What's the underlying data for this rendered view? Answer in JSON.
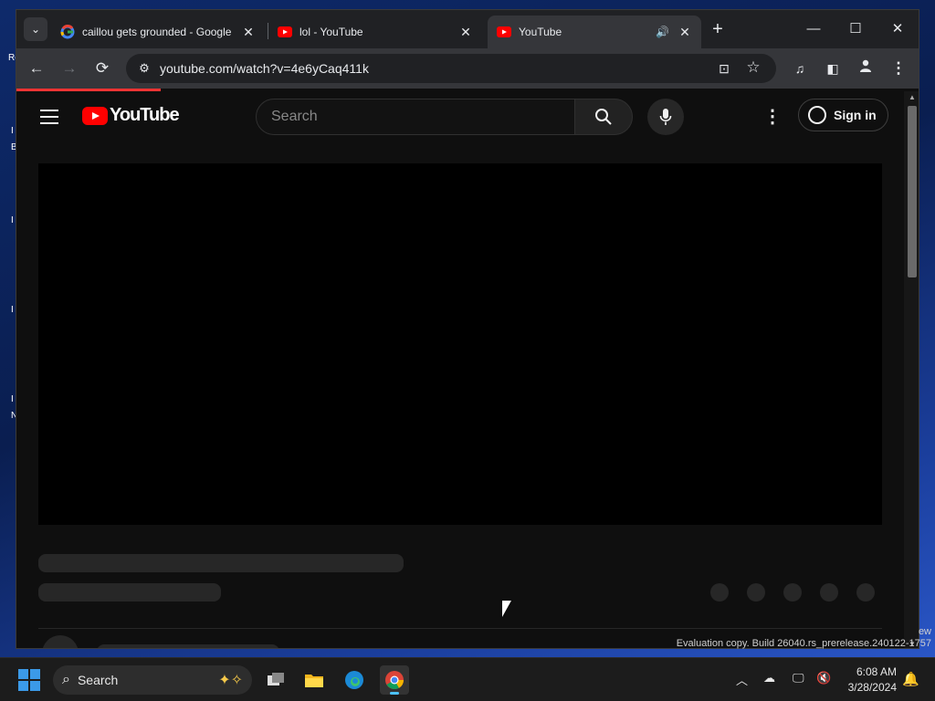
{
  "desktop": {
    "partial_text": [
      "Re",
      "I",
      "B",
      "I",
      "I",
      "I",
      "N"
    ]
  },
  "browser": {
    "tabs": [
      {
        "title": "caillou gets grounded - Google",
        "favicon": "google-icon",
        "active": false
      },
      {
        "title": "lol - YouTube",
        "favicon": "youtube-icon",
        "active": false
      },
      {
        "title": "YouTube",
        "favicon": "youtube-icon",
        "active": true,
        "audio": true
      }
    ],
    "tab_close_glyph": "✕",
    "new_tab_glyph": "+",
    "window_controls": {
      "minimize": "—",
      "maximize": "☐",
      "close": "✕"
    },
    "nav": {
      "back": "←",
      "forward": "→",
      "reload": "⟳"
    },
    "url": "youtube.com/watch?v=4e6yCaq411k",
    "toolbar_icons": [
      "install-app-icon",
      "bookmark-star-icon",
      "media-controls-icon",
      "side-panel-icon",
      "profile-icon",
      "menu-icon"
    ]
  },
  "youtube": {
    "logo_text": "YouTube",
    "search_placeholder": "Search",
    "signin_label": "Sign in",
    "more_glyph": "⋮",
    "accent": "#ff0000"
  },
  "watermark": {
    "line1": "ew",
    "line2": "Evaluation copy. Build 26040.rs_prerelease.240122-1757"
  },
  "taskbar": {
    "search_label": "Search",
    "apps": [
      "task-view-icon",
      "file-explorer-icon",
      "edge-icon",
      "chrome-icon"
    ],
    "active_app": "chrome-icon",
    "time": "6:08 AM",
    "date": "3/28/2024"
  }
}
